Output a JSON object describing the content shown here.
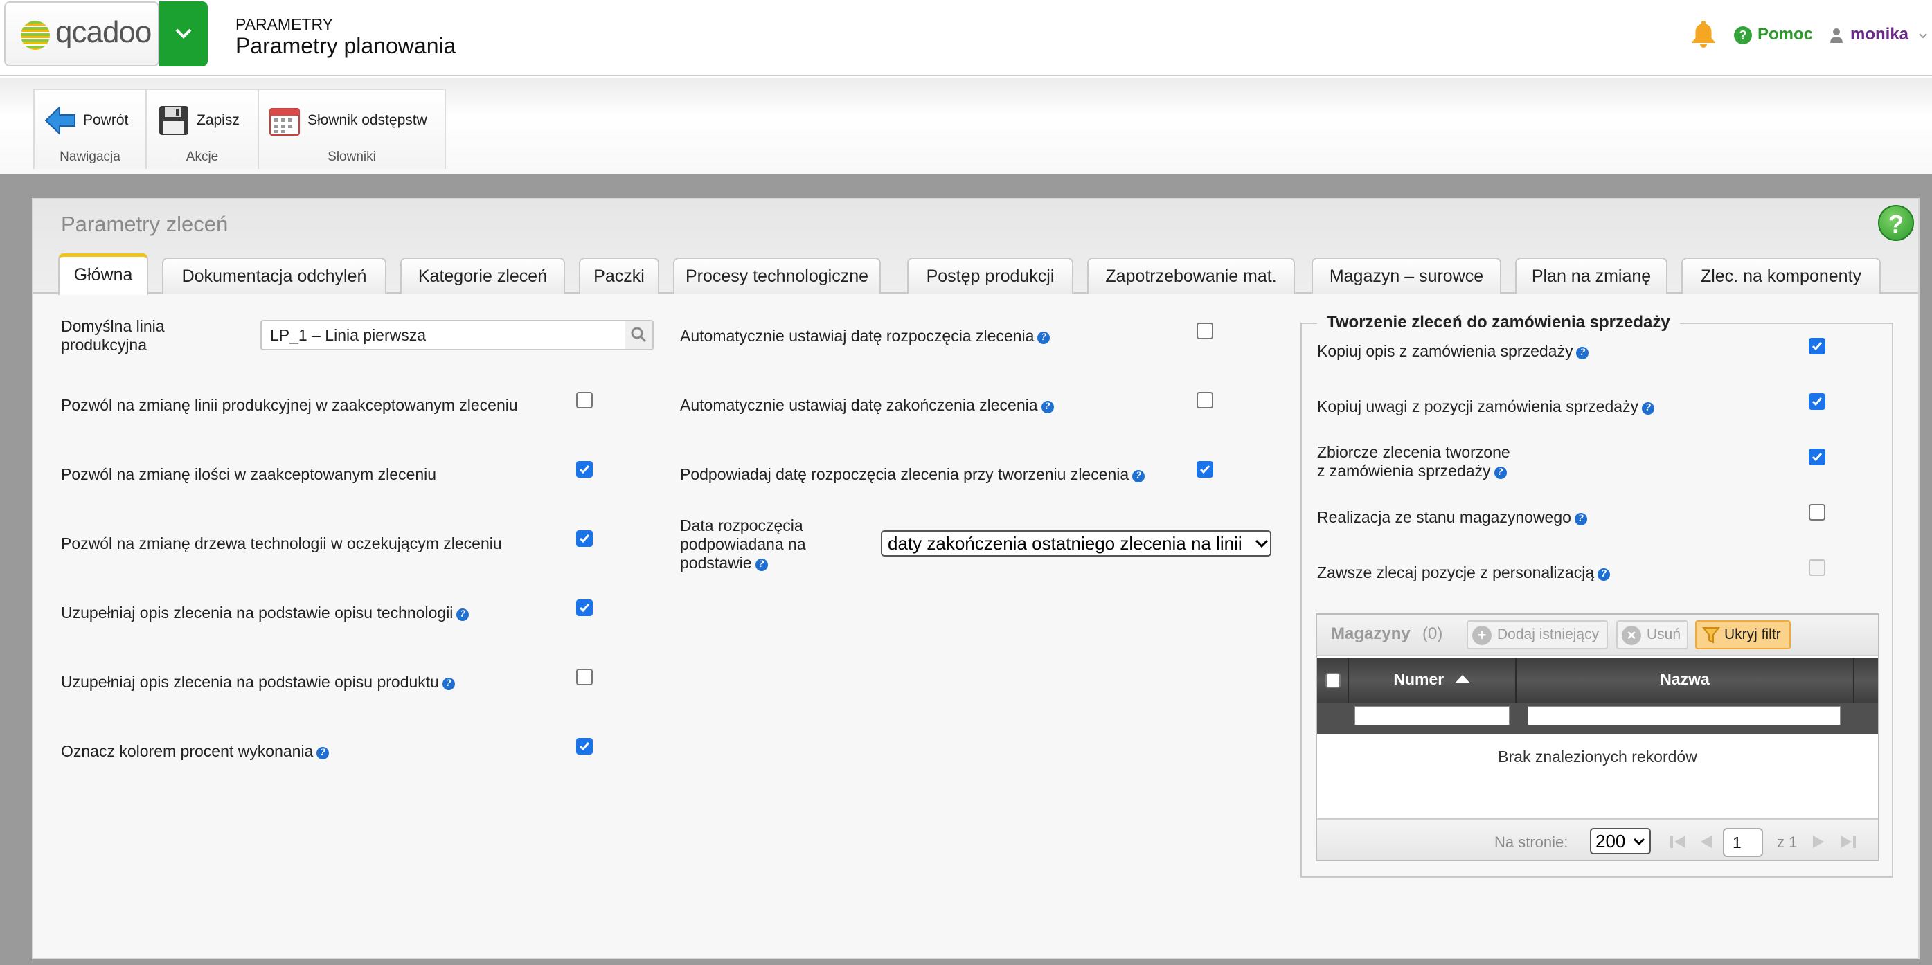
{
  "header": {
    "logo_text": "qcadoo",
    "section": "PARAMETRY",
    "title": "Parametry planowania",
    "help_label": "Pomoc",
    "user_name": "monika"
  },
  "ribbon": {
    "groups": [
      {
        "label": "Nawigacja",
        "buttons": [
          {
            "label": "Powrót",
            "icon": "back-arrow-icon"
          }
        ]
      },
      {
        "label": "Akcje",
        "buttons": [
          {
            "label": "Zapisz",
            "icon": "save-icon"
          }
        ]
      },
      {
        "label": "Słowniki",
        "buttons": [
          {
            "label": "Słownik odstępstw",
            "icon": "calendar-icon"
          }
        ]
      }
    ]
  },
  "panel": {
    "title": "Parametry zleceń",
    "tabs": [
      {
        "label": "Główna",
        "active": true
      },
      {
        "label": "Dokumentacja odchyleń"
      },
      {
        "label": "Kategorie zleceń"
      },
      {
        "label": "Paczki"
      },
      {
        "label": "Procesy technologiczne"
      },
      {
        "label": "Postęp produkcji"
      },
      {
        "label": "Zapotrzebowanie mat."
      },
      {
        "label": "Magazyn – surowce"
      },
      {
        "label": "Plan na zmianę"
      },
      {
        "label": "Zlec. na komponenty"
      }
    ]
  },
  "form": {
    "left": {
      "default_line_label": "Domyślna linia produkcyjna",
      "default_line_value": "LP_1 – Linia pierwsza",
      "fields": [
        {
          "label": "Pozwól na zmianę linii produkcyjnej w zaakceptowanym zleceniu",
          "checked": false,
          "info": false
        },
        {
          "label": "Pozwól na zmianę ilości w zaakceptowanym zleceniu",
          "checked": true,
          "info": false
        },
        {
          "label": "Pozwól na zmianę drzewa technologii w oczekującym zleceniu",
          "checked": true,
          "info": false
        },
        {
          "label": "Uzupełniaj opis zlecenia na podstawie opisu technologii",
          "checked": true,
          "info": true
        },
        {
          "label": "Uzupełniaj opis zlecenia na podstawie opisu produktu",
          "checked": false,
          "info": true
        },
        {
          "label": "Oznacz kolorem procent wykonania",
          "checked": true,
          "info": true
        }
      ]
    },
    "middle": {
      "fields": [
        {
          "label": "Automatycznie ustawiaj datę rozpoczęcia zlecenia",
          "checked": false
        },
        {
          "label": "Automatycznie ustawiaj datę zakończenia zlecenia",
          "checked": false
        },
        {
          "label": "Podpowiadaj datę rozpoczęcia zlecenia przy tworzeniu zlecenia",
          "checked": true
        }
      ],
      "start_date_label_1": "Data rozpoczęcia",
      "start_date_label_2": "podpowiadana na",
      "start_date_label_3": "podstawie",
      "start_date_value": "daty zakończenia ostatniego zlecenia na linii"
    },
    "right": {
      "legend": "Tworzenie zleceń do zamówienia sprzedaży",
      "fields": [
        {
          "label": "Kopiuj opis z zamówienia sprzedaży",
          "checked": true
        },
        {
          "label": "Kopiuj uwagi z pozycji zamówienia sprzedaży",
          "checked": true
        },
        {
          "label_1": "Zbiorcze zlecenia tworzone",
          "label_2": "z zamówienia sprzedaży",
          "checked": true
        },
        {
          "label": "Realizacja ze stanu magazynowego",
          "checked": false
        },
        {
          "label": "Zawsze zlecaj pozycje z personalizacją",
          "checked": false,
          "disabled": true
        }
      ],
      "grid": {
        "title": "Magazyny",
        "count": "(0)",
        "add_label": "Dodaj istniejący",
        "remove_label": "Usuń",
        "filter_label": "Ukryj filtr",
        "columns": [
          "Numer",
          "Nazwa"
        ],
        "empty_text": "Brak znalezionych rekordów",
        "per_page_label": "Na stronie:",
        "per_page_value": "200",
        "page_value": "1",
        "page_of": "z 1"
      }
    }
  },
  "colors": {
    "accent_green": "#1aa12f",
    "checkbox_blue": "#1a73e8",
    "tab_active": "#f0c419"
  }
}
